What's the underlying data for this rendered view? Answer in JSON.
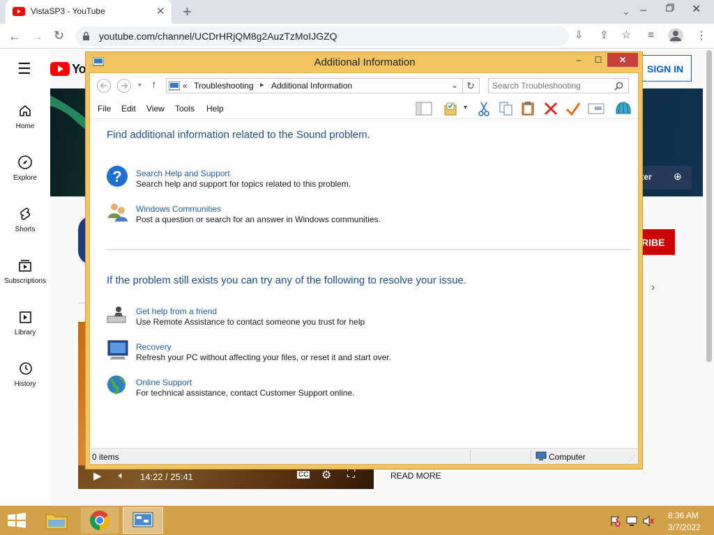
{
  "browser": {
    "tab_title": "VistaSP3 - YouTube",
    "url": "youtube.com/channel/UCDrHRjQM8g2AuzTzMoIJGZQ"
  },
  "youtube": {
    "logo_text": "YouTube",
    "sign_in": "SIGN IN",
    "nav": [
      {
        "label": "Home"
      },
      {
        "label": "Explore"
      },
      {
        "label": "Shorts"
      },
      {
        "label": "Subscriptions"
      },
      {
        "label": "Library"
      },
      {
        "label": "History"
      }
    ],
    "banner_text": "nter",
    "subscribe_label": "RIBE",
    "video_time": "14:22 / 25:41",
    "read_more": "READ MORE"
  },
  "explorer": {
    "title": "Additional Information",
    "breadcrumb": [
      "Troubleshooting",
      "Additional Information"
    ],
    "breadcrumb_prefix": "«",
    "search_placeholder": "Search Troubleshooting",
    "menu": [
      "File",
      "Edit",
      "View",
      "Tools",
      "Help"
    ],
    "heading1": "Find additional information related to the Sound problem.",
    "section1": [
      {
        "title": "Search Help and Support",
        "desc": "Search help and support for topics related to this problem.",
        "icon": "help-icon"
      },
      {
        "title": "Windows Communities",
        "desc": "Post a question or search for an answer in Windows communities.",
        "icon": "people-icon"
      }
    ],
    "heading2": "If the problem still exists you can try any of the following to resolve your issue.",
    "section2": [
      {
        "title": "Get help from a friend",
        "desc": "Use Remote Assistance to contact someone you trust for help",
        "icon": "remote-assistance-icon"
      },
      {
        "title": "Recovery",
        "desc": "Refresh your PC without affecting your files, or reset it and start over.",
        "icon": "recovery-icon"
      },
      {
        "title": "Online Support",
        "desc": "For technical assistance, contact Customer Support online.",
        "icon": "globe-icon"
      }
    ],
    "status_items": "0 items",
    "status_location": "Computer"
  },
  "taskbar": {
    "time": "8:36 AM",
    "date": "3/7/2022"
  }
}
